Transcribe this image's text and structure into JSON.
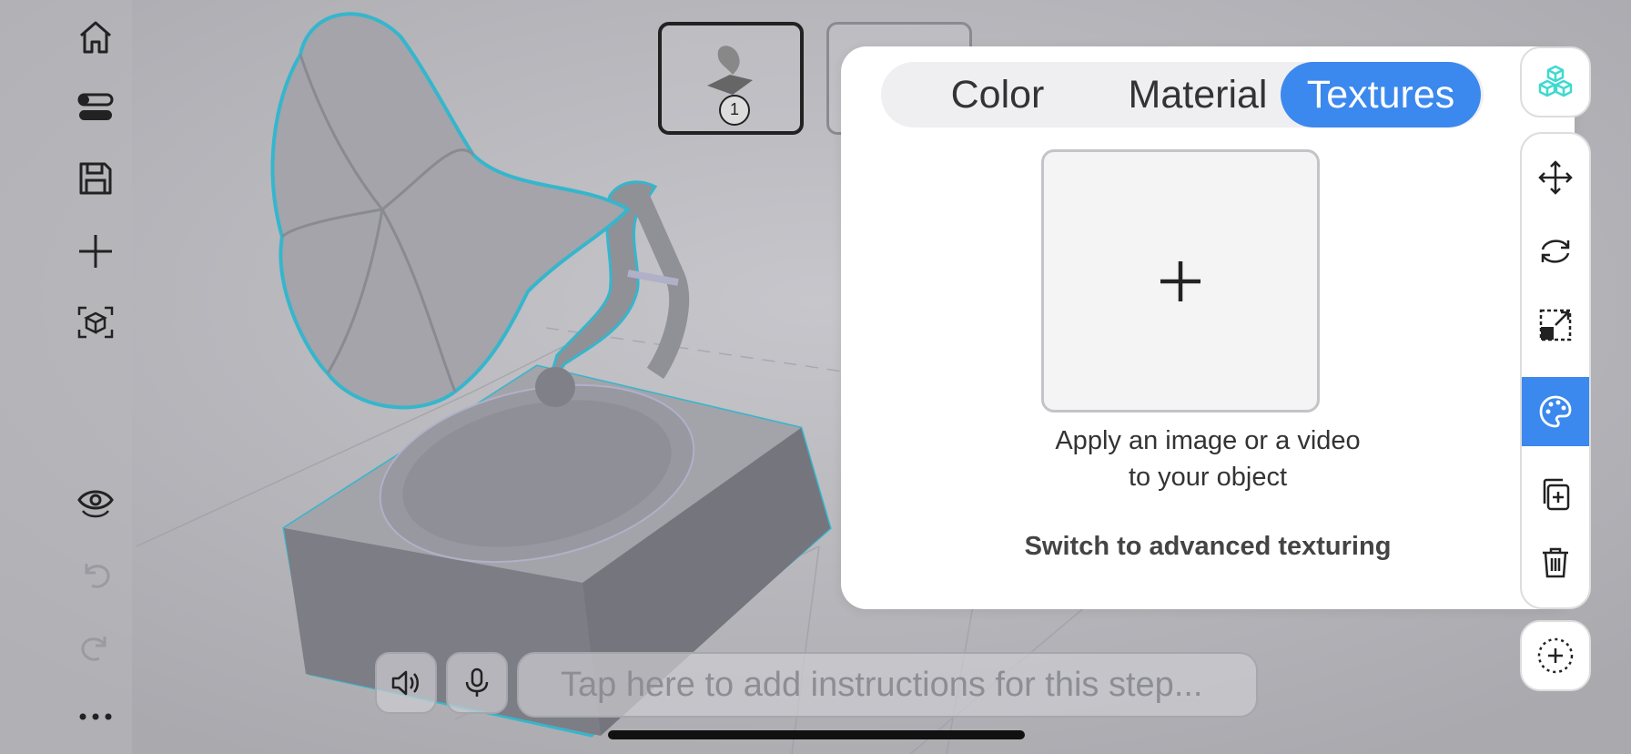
{
  "left_toolbar": {
    "items": [
      {
        "icon": "home-icon"
      },
      {
        "icon": "toggles-icon"
      },
      {
        "icon": "save-icon"
      },
      {
        "icon": "plus-icon"
      },
      {
        "icon": "ar-cube-icon"
      },
      {
        "icon": "eye-rotate-icon"
      },
      {
        "icon": "undo-icon",
        "enabled": false
      },
      {
        "icon": "redo-icon",
        "enabled": false
      },
      {
        "icon": "more-icon"
      }
    ]
  },
  "steps": {
    "active_number": "1"
  },
  "panel": {
    "tabs": [
      {
        "label": "Color"
      },
      {
        "label": "Material"
      },
      {
        "label": "Textures",
        "active": true
      }
    ],
    "apply_text_line1": "Apply an image or a video",
    "apply_text_line2": "to your object",
    "advanced_link": "Switch to advanced texturing"
  },
  "right_toolbar": {
    "top_icon": "cubes-icon",
    "tools": [
      {
        "icon": "move-icon"
      },
      {
        "icon": "rotate-icon"
      },
      {
        "icon": "scale-icon"
      },
      {
        "icon": "palette-icon",
        "active": true
      },
      {
        "icon": "duplicate-icon"
      },
      {
        "icon": "trash-icon"
      }
    ],
    "bottom_icon": "add-anchor-icon"
  },
  "bottom_bar": {
    "instructions_placeholder": "Tap here to add instructions for this step..."
  },
  "colors": {
    "accent": "#3b88ee",
    "panel_bg": "#ffffff",
    "selection_outline": "#35b6cc",
    "highlight_cube": "#3fd9d0"
  }
}
